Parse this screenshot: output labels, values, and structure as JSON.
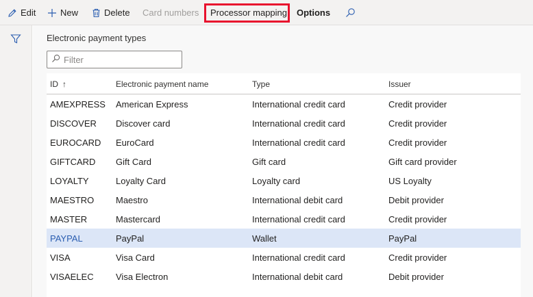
{
  "toolbar": {
    "edit": "Edit",
    "new": "New",
    "delete": "Delete",
    "card_numbers": "Card numbers",
    "processor_mapping": "Processor mapping",
    "options": "Options"
  },
  "main": {
    "section_title": "Electronic payment types",
    "filter_placeholder": "Filter"
  },
  "table": {
    "columns": [
      "ID",
      "Electronic payment name",
      "Type",
      "Issuer"
    ],
    "sort_indicator": "↑",
    "selected_row": 7,
    "rows": [
      {
        "id": "AMEXPRESS",
        "name": "American Express",
        "type": "International credit card",
        "issuer": "Credit provider"
      },
      {
        "id": "DISCOVER",
        "name": "Discover card",
        "type": "International credit card",
        "issuer": "Credit provider"
      },
      {
        "id": "EUROCARD",
        "name": "EuroCard",
        "type": "International credit card",
        "issuer": "Credit provider"
      },
      {
        "id": "GIFTCARD",
        "name": "Gift Card",
        "type": "Gift card",
        "issuer": "Gift card provider"
      },
      {
        "id": "LOYALTY",
        "name": "Loyalty Card",
        "type": "Loyalty card",
        "issuer": "US Loyalty"
      },
      {
        "id": "MAESTRO",
        "name": "Maestro",
        "type": "International debit card",
        "issuer": "Debit provider"
      },
      {
        "id": "MASTER",
        "name": "Mastercard",
        "type": "International credit card",
        "issuer": "Credit provider"
      },
      {
        "id": "PAYPAL",
        "name": "PayPal",
        "type": "Wallet",
        "issuer": "PayPal"
      },
      {
        "id": "VISA",
        "name": "Visa Card",
        "type": "International credit card",
        "issuer": "Credit provider"
      },
      {
        "id": "VISAELEC",
        "name": "Visa Electron",
        "type": "International debit card",
        "issuer": "Debit provider"
      }
    ]
  },
  "icons": {
    "edit": "pencil-icon",
    "new": "plus-icon",
    "delete": "trash-icon",
    "search": "search-icon",
    "filter": "funnel-icon"
  },
  "colors": {
    "highlight_border": "#e8112d",
    "selected_row": "#dce6f7",
    "accent": "#2a5db0"
  }
}
